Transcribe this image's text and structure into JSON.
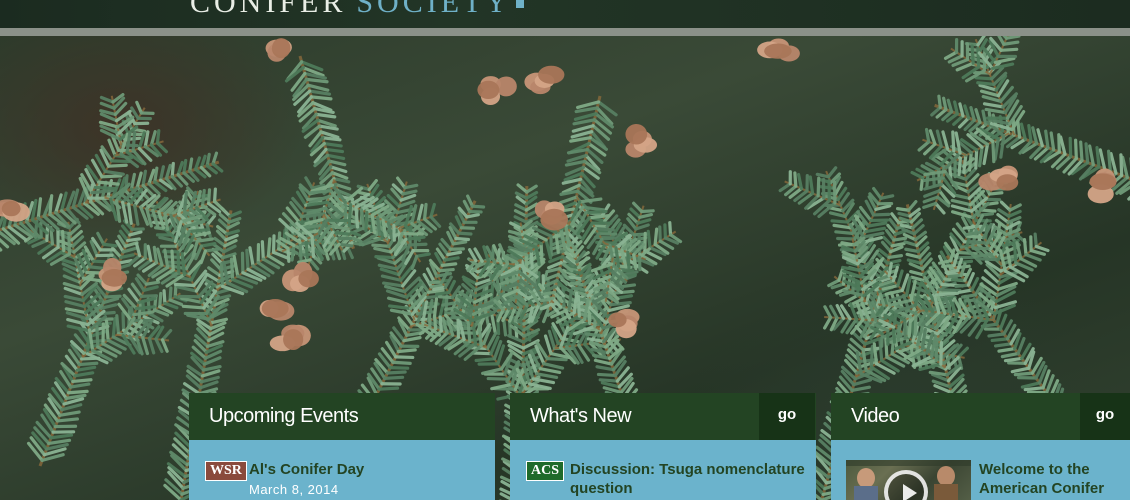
{
  "header": {
    "logo_word_1": "CONIFER",
    "logo_word_2": "SOCIETY"
  },
  "colors": {
    "panel_header": "#234423",
    "go_button": "#173317",
    "panel_body": "#6bb3cc",
    "logo_accent": "#6fb1c8",
    "badge_wsr": "#8a4a3c",
    "badge_acs": "#1f6a2a"
  },
  "panels": {
    "events": {
      "title": "Upcoming Events",
      "item": {
        "badge": "WSR",
        "title": "Al's Conifer Day",
        "date": "March 8, 2014"
      }
    },
    "news": {
      "title": "What's New",
      "go_label": "go",
      "item": {
        "badge": "ACS",
        "title": "Discussion: Tsuga nomenclature question"
      }
    },
    "video": {
      "title": "Video",
      "go_label": "go",
      "item": {
        "thumb_icon": "play-icon",
        "title": "Welcome to the American Conifer"
      }
    }
  }
}
